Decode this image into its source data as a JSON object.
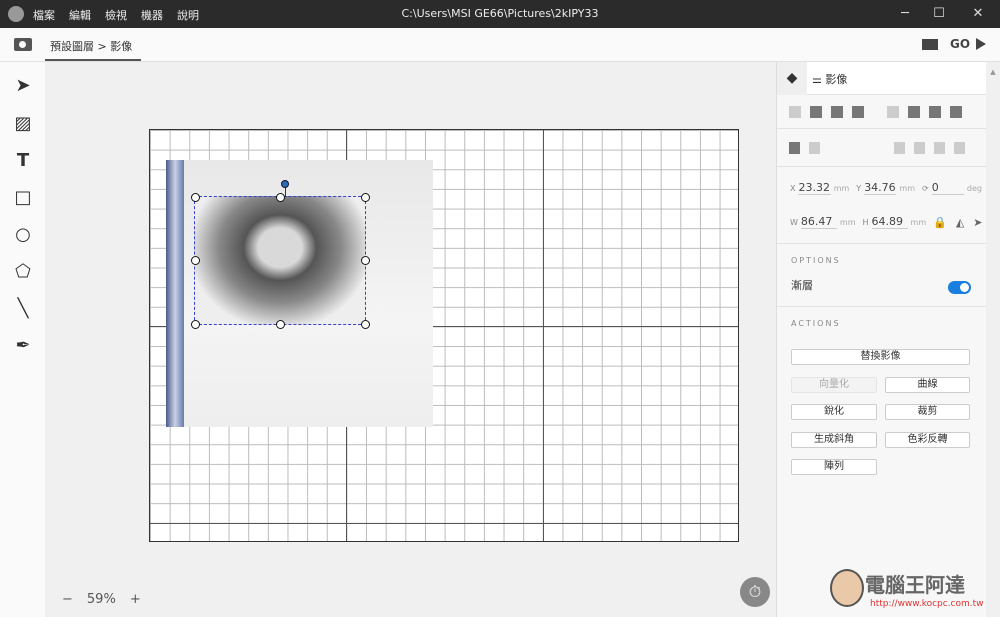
{
  "titlebar": {
    "menu": [
      "檔案",
      "編輯",
      "檢視",
      "機器",
      "說明"
    ],
    "title": "C:\\Users\\MSI GE66\\Pictures\\2kIPY33",
    "min": "─",
    "max": "☐",
    "close": "✕"
  },
  "toolbar": {
    "breadcrumb": "預設圖層 > 影像",
    "go": "GO"
  },
  "tools": [
    "select",
    "image",
    "text",
    "rectangle",
    "ellipse",
    "polygon",
    "line",
    "pen"
  ],
  "zoom": {
    "minus": "−",
    "value": "59%",
    "plus": "+"
  },
  "panel": {
    "tab": "影像",
    "x": "23.32",
    "y": "34.76",
    "rotation": "0",
    "w": "86.47",
    "h": "64.89",
    "labels": {
      "x": "X",
      "y": "Y",
      "rot": "⟳",
      "w": "W",
      "h": "H",
      "mm": "mm",
      "deg": "deg"
    },
    "options_title": "OPTIONS",
    "option_label": "漸層",
    "option_on": true,
    "actions_title": "ACTIONS",
    "actions": {
      "replace": "替換影像",
      "vectorize": "向量化",
      "curves": "曲線",
      "sharpen": "銳化",
      "crop": "裁剪",
      "bevel": "生成斜角",
      "invert": "色彩反轉",
      "array": "陣列"
    }
  },
  "watermark": {
    "text": "電腦王阿達",
    "url": "http://www.kocpc.com.tw"
  },
  "colors": {
    "accent": "#1a7ee0",
    "titlebar": "#2b2b2b"
  }
}
